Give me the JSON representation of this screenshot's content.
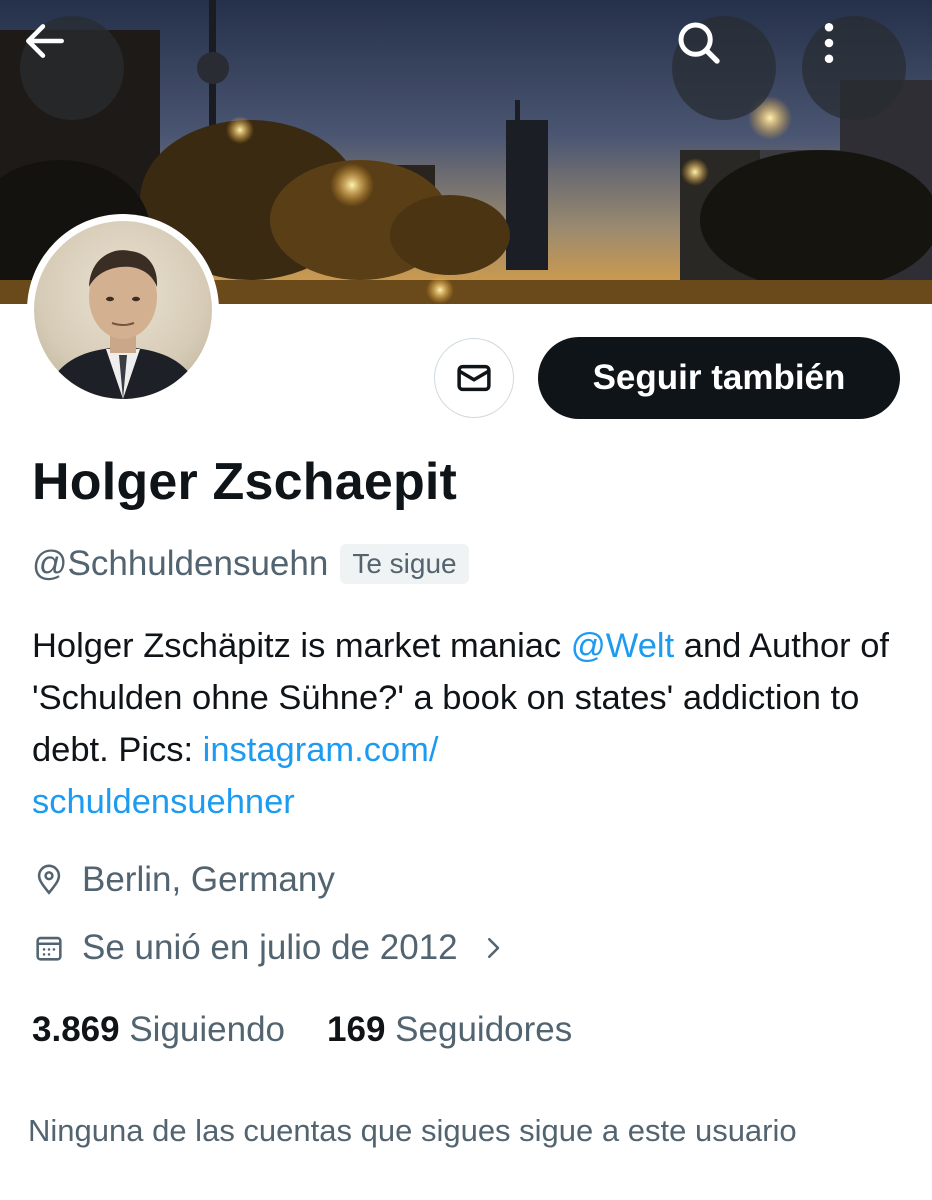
{
  "header": {
    "back_icon": "arrow-left-icon",
    "search_icon": "search-icon",
    "more_icon": "more-vertical-icon"
  },
  "profile": {
    "name": "Holger Zschaepit",
    "handle": "@Schhuldensuehn",
    "follows_you": "Te sigue",
    "follow_button": "Seguir también",
    "message_icon": "envelope-icon",
    "bio": {
      "part1": "Holger Zschäpitz is market maniac ",
      "mention": "@Welt",
      "part2": " and Author of 'Schulden ohne Sühne?' a book on states' addiction to debt. Pics: ",
      "link": "instagram.com/schuldensuehner",
      "link_line1": "instagram.com/",
      "link_line2": "schuldensuehner"
    },
    "location": "Berlin, Germany",
    "joined": "Se unió en julio de 2012",
    "following_count": "3.869",
    "following_label": "Siguiendo",
    "followers_count": "169",
    "followers_label": "Seguidores",
    "mutuals_note": "Ninguna de las cuentas que sigues sigue a este usuario"
  },
  "colors": {
    "accent": "#1d9bf0",
    "text": "#0f1419",
    "secondary": "#536471",
    "button_dark": "#0f1419"
  }
}
